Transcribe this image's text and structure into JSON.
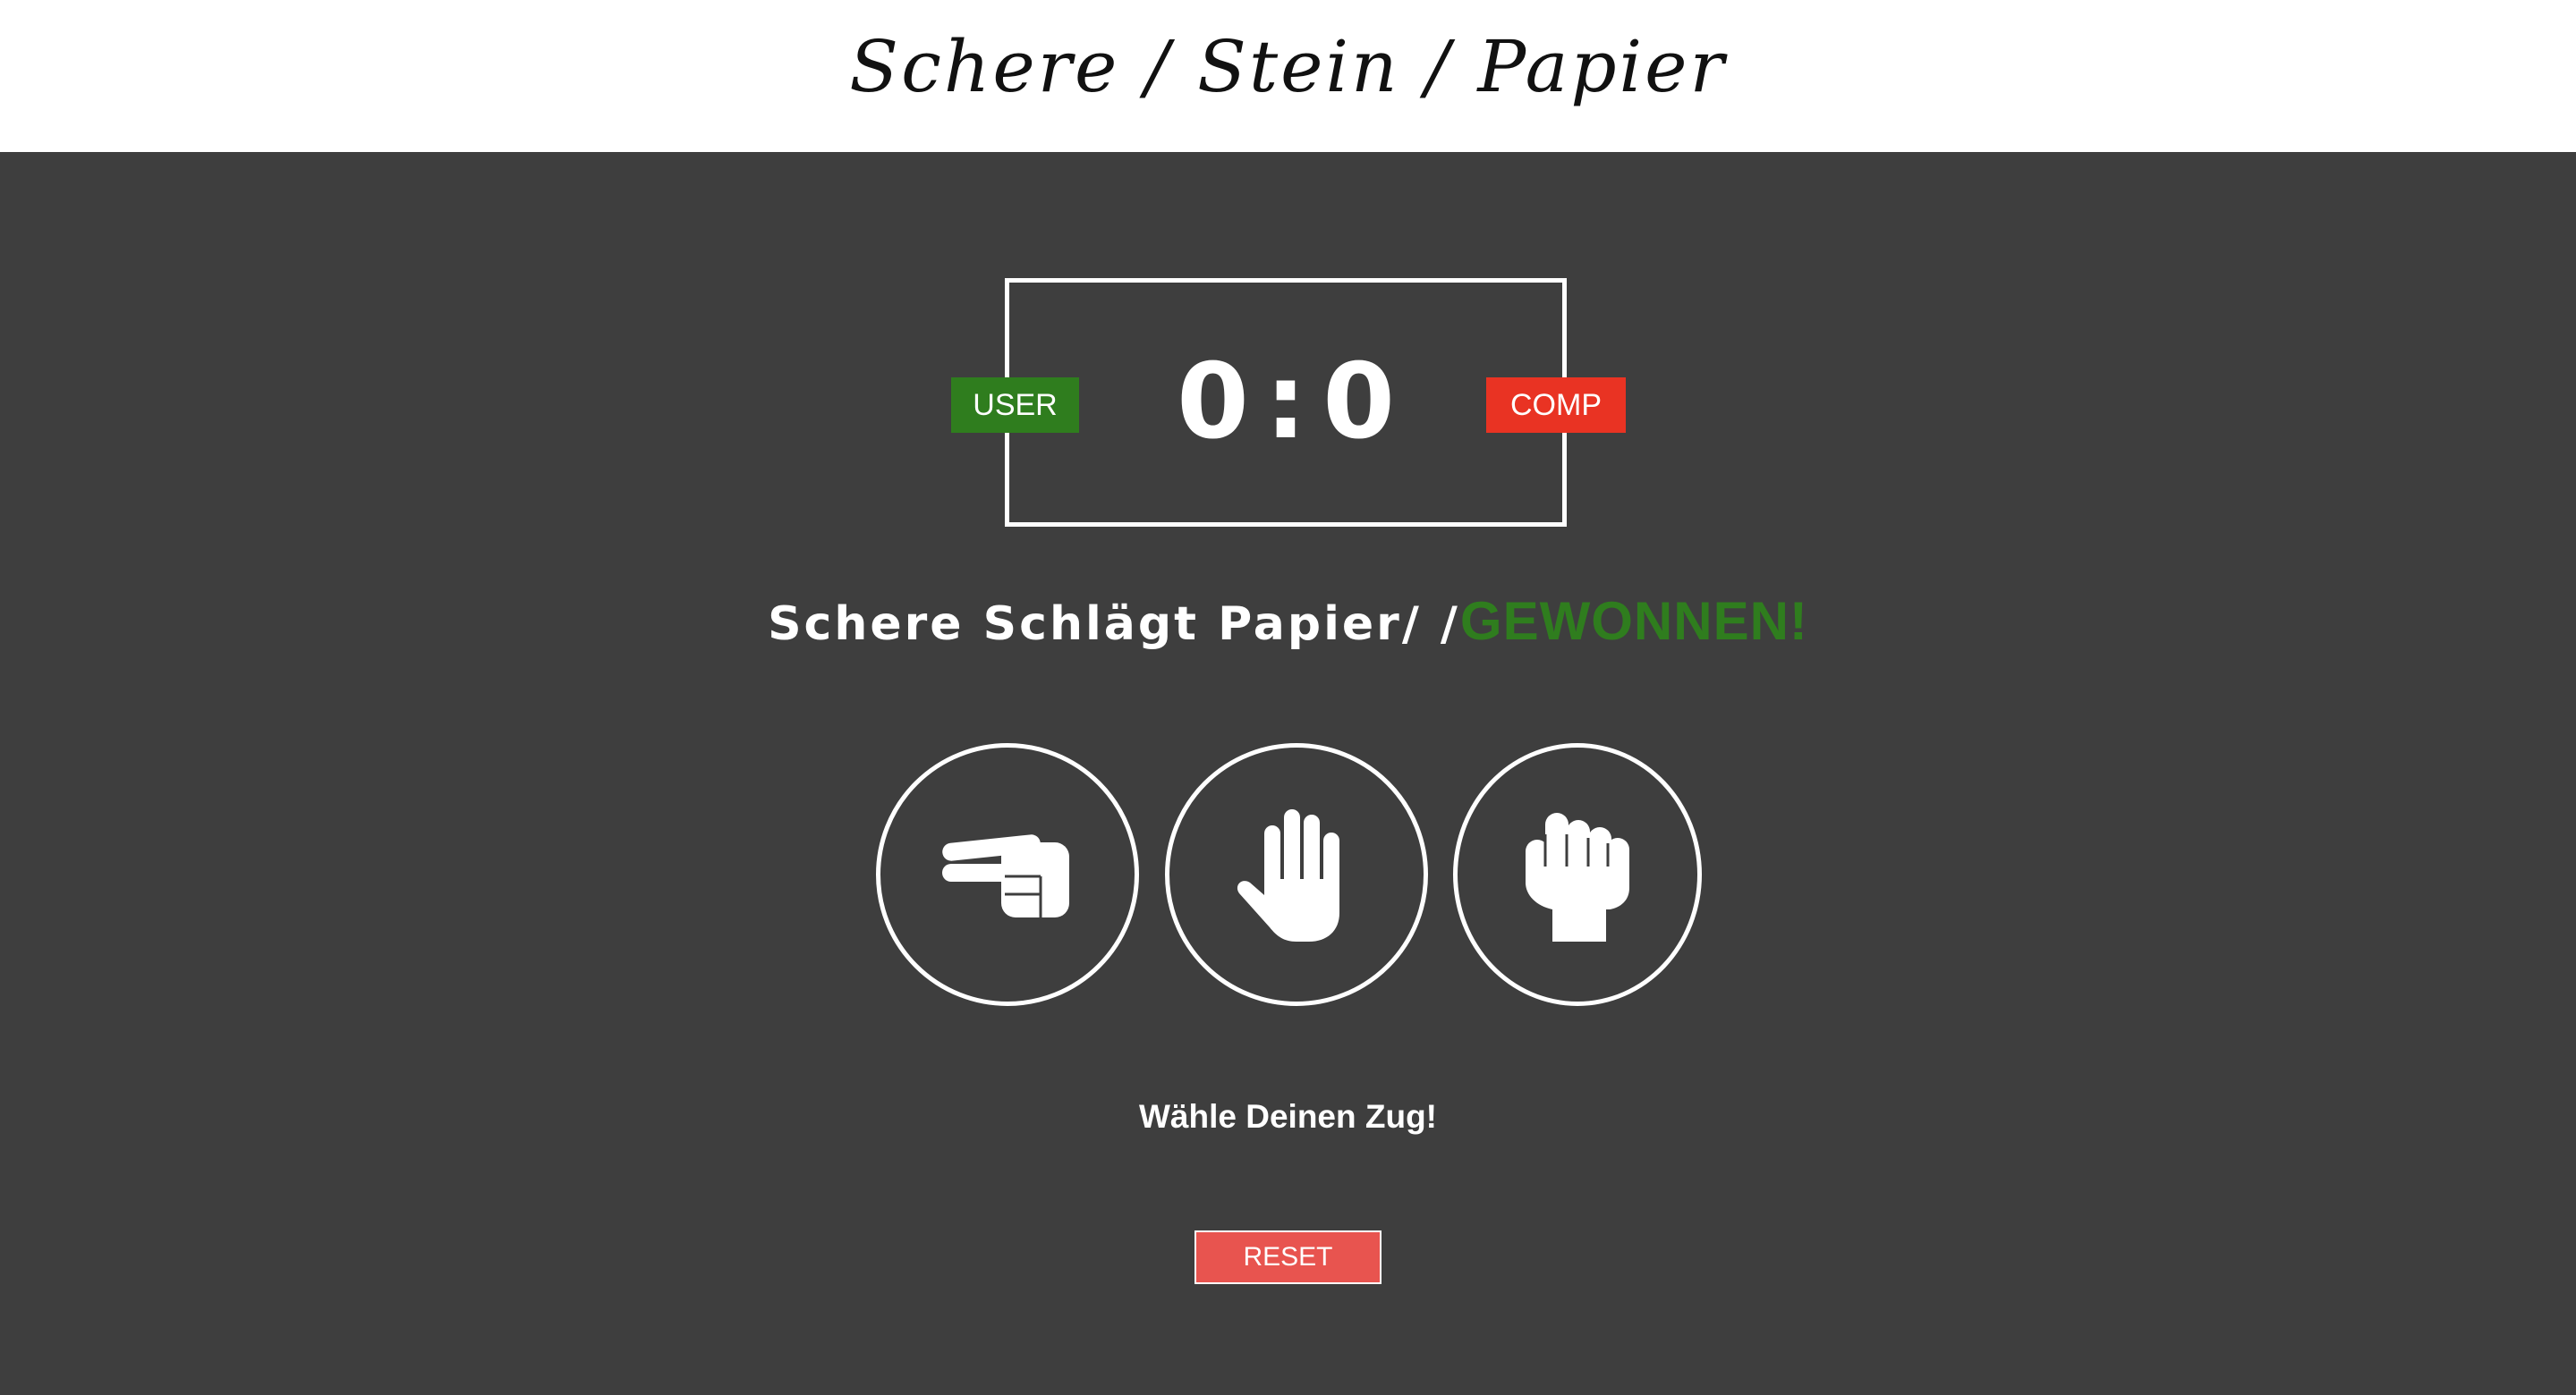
{
  "header": {
    "title": "Schere / Stein / Papier"
  },
  "scoreboard": {
    "user_label": "USER",
    "comp_label": "COMP",
    "user_score": "0",
    "separator": ":",
    "comp_score": "0",
    "user_color": "#2f7d1e",
    "comp_color": "#e93323"
  },
  "result": {
    "message": "Schere Schlägt Papier/ /",
    "outcome": "GEWONNEN!",
    "outcome_color": "#2f7d1e"
  },
  "choices": [
    {
      "name": "scissors",
      "icon": "hand-scissors-icon"
    },
    {
      "name": "paper",
      "icon": "hand-paper-icon"
    },
    {
      "name": "rock",
      "icon": "hand-rock-icon"
    }
  ],
  "prompt": "Wähle Deinen Zug!",
  "reset_label": "RESET",
  "colors": {
    "background": "#3e3e3e",
    "header_background": "#ffffff",
    "reset_button": "#e8544f"
  }
}
